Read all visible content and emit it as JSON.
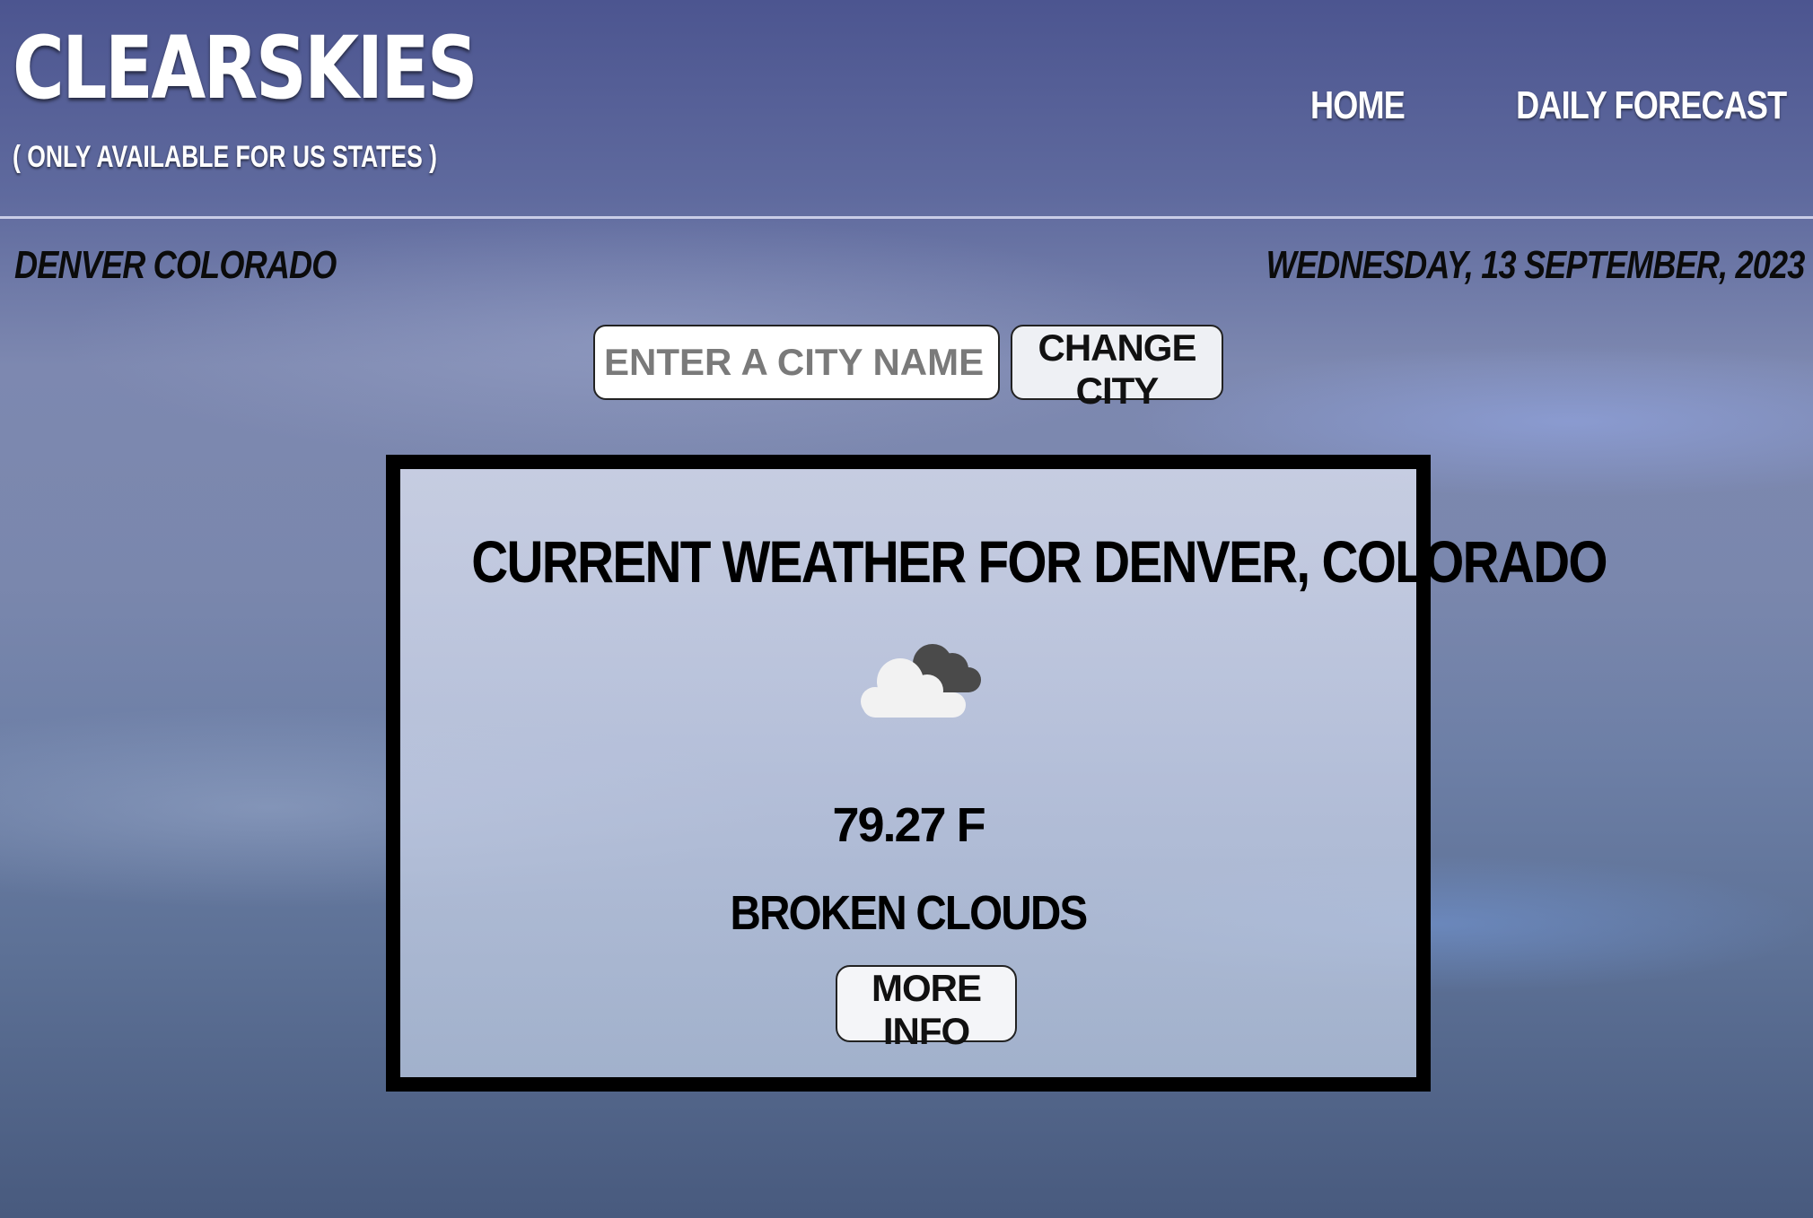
{
  "header": {
    "brand": "CLEARSKIES",
    "subtitle": "( ONLY AVAILABLE FOR US STATES )",
    "nav": [
      {
        "label": "HOME"
      },
      {
        "label": "DAILY FORECAST"
      }
    ]
  },
  "info_bar": {
    "location": "DENVER COLORADO",
    "date": "WEDNESDAY, 13 SEPTEMBER, 2023"
  },
  "search": {
    "placeholder": "ENTER A CITY NAME",
    "value": "",
    "button_label": "CHANGE CITY"
  },
  "weather_card": {
    "title": "CURRENT WEATHER FOR DENVER, COLORADO",
    "icon": "broken-clouds-icon",
    "temperature": "79.27 F",
    "description": "BROKEN CLOUDS",
    "more_button_label": "MORE INFO"
  },
  "colors": {
    "text_dark": "#000000",
    "text_light": "#ffffff",
    "card_border": "#000000"
  }
}
